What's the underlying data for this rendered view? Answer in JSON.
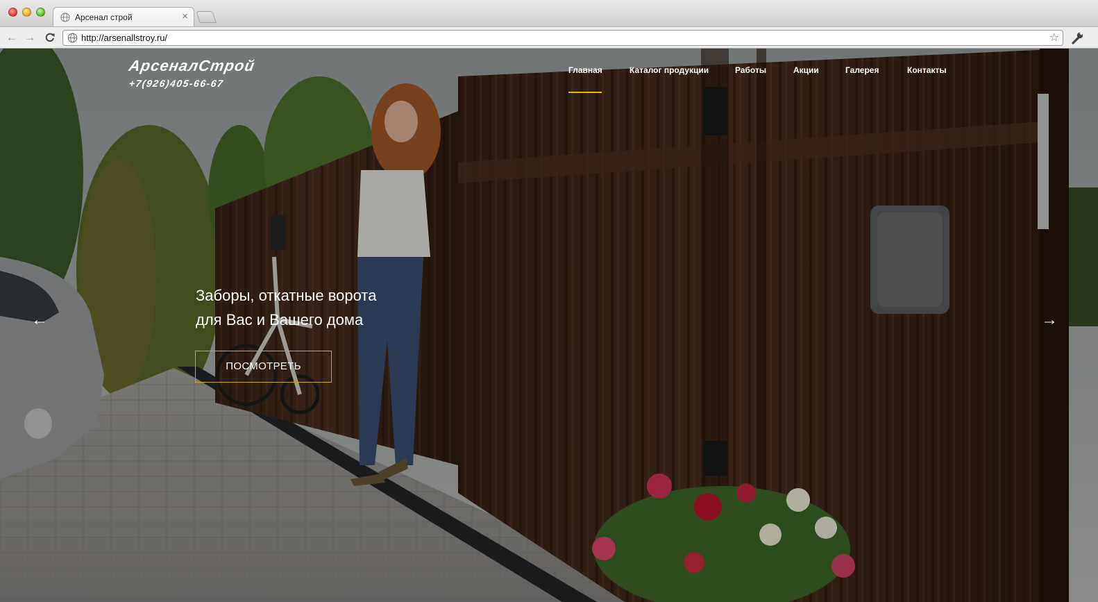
{
  "browser": {
    "tab_title": "Арсенал строй",
    "tab_close": "×",
    "url": "http://arsenallstroy.ru/",
    "bookmark_star": "☆",
    "back": "←",
    "forward": "→",
    "reload": "C"
  },
  "site": {
    "logo_name": "АрсеналСтрой",
    "logo_phone": "+7(926)405-66-67",
    "nav": [
      {
        "label": "Главная",
        "active": true
      },
      {
        "label": "Каталог продукции"
      },
      {
        "label": "Работы"
      },
      {
        "label": "Акции"
      },
      {
        "label": "Галерея"
      },
      {
        "label": "Контакты"
      }
    ],
    "accent_color": "#e6b800"
  },
  "slider": {
    "headline_line1": "Заборы, откатные ворота",
    "headline_line2": "для Вас и Вашего дома",
    "cta_label": "ПОСМОТРЕТЬ",
    "prev_arrow": "←",
    "next_arrow": "→"
  }
}
